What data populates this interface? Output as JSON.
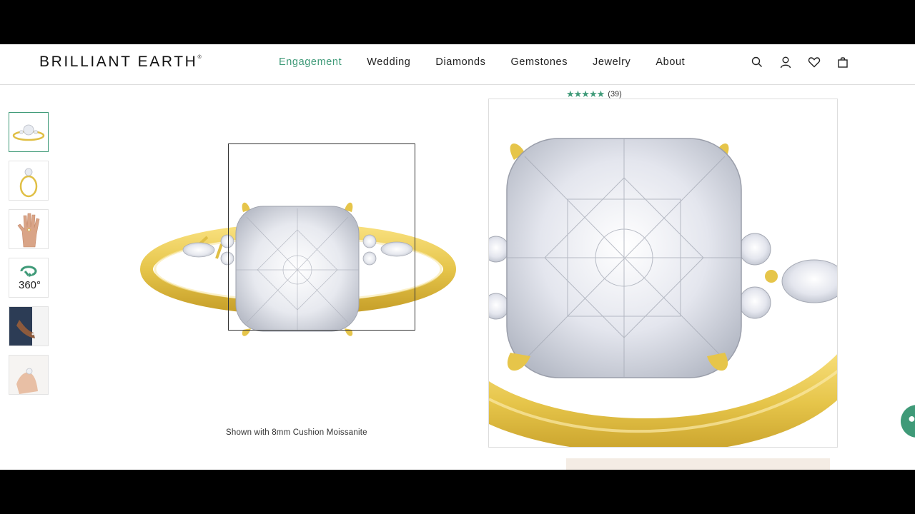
{
  "brand": {
    "name": "BRILLIANT EARTH",
    "mark": "®"
  },
  "nav": [
    {
      "label": "Engagement",
      "active": true
    },
    {
      "label": "Wedding",
      "active": false
    },
    {
      "label": "Diamonds",
      "active": false
    },
    {
      "label": "Gemstones",
      "active": false
    },
    {
      "label": "Jewelry",
      "active": false
    },
    {
      "label": "About",
      "active": false
    }
  ],
  "header_icons": [
    "search-icon",
    "account-icon",
    "wishlist-heart-icon",
    "shopping-bag-icon"
  ],
  "thumbnails": [
    {
      "name": "thumb-ring-front",
      "active": true
    },
    {
      "name": "thumb-ring-side",
      "active": false
    },
    {
      "name": "thumb-hand",
      "active": false
    },
    {
      "name": "thumb-360",
      "label": "360°",
      "active": false
    },
    {
      "name": "thumb-model",
      "active": false
    },
    {
      "name": "thumb-hand-held",
      "active": false
    }
  ],
  "product": {
    "caption": "Shown with 8mm Cushion Moissanite",
    "rating": {
      "stars": "★★★★★",
      "count": "(39)",
      "value": 5
    }
  },
  "colors": {
    "accent": "#3f9a78",
    "gold": "#e9c84a"
  }
}
